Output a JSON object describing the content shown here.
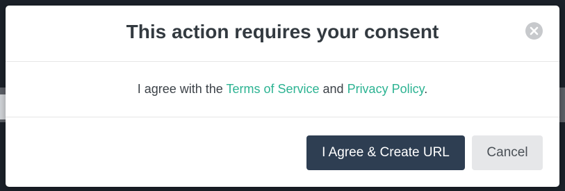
{
  "modal": {
    "title": "This action requires your consent",
    "body": {
      "prefix": "I agree with the ",
      "terms_link": "Terms of Service",
      "middle": " and ",
      "privacy_link": "Privacy Policy",
      "suffix": "."
    },
    "buttons": {
      "agree_label": "I Agree & Create URL",
      "cancel_label": "Cancel"
    },
    "close_icon": "close-icon"
  },
  "colors": {
    "link": "#2cb392",
    "primary_button": "#2e3e52",
    "secondary_button": "#e6e7e9",
    "close_icon_bg": "#c7c9cc"
  }
}
